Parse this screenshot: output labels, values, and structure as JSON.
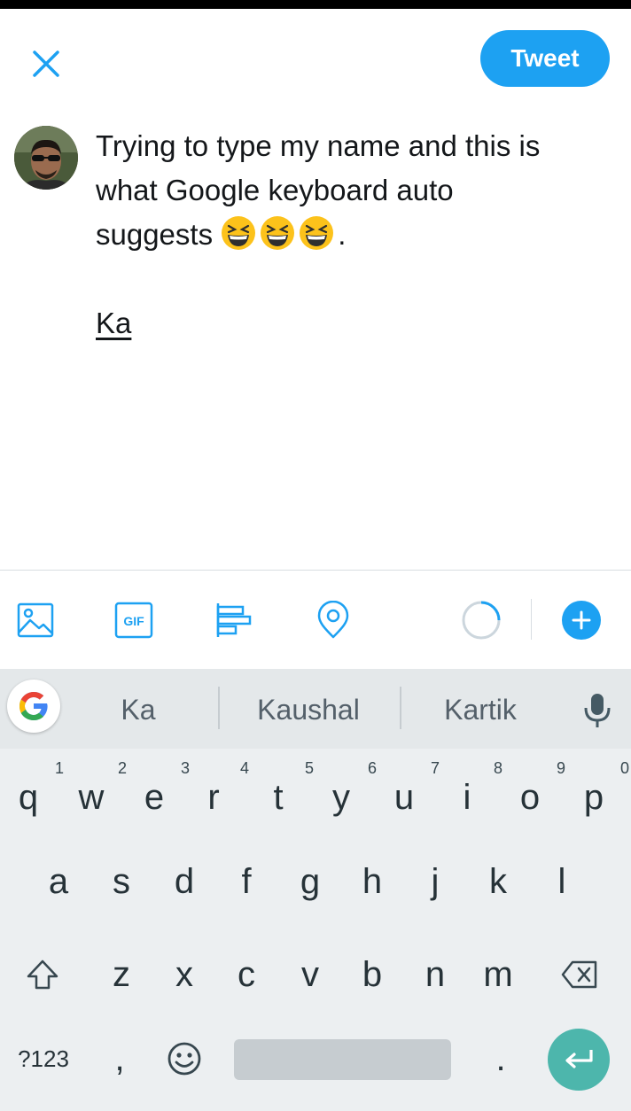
{
  "compose": {
    "tweet_label": "Tweet",
    "lines": [
      "Trying to type my name and this is",
      "what Google keyboard auto",
      "suggests"
    ],
    "emoji_name": "grinning-squinting-face",
    "emoji_count": 3,
    "after_emoji": ".",
    "composing_word": "Ka"
  },
  "toolbar": {
    "icons": [
      "image-icon",
      "gif-icon",
      "poll-icon",
      "location-icon"
    ],
    "gif_label": "GIF",
    "accent_color": "#1da1f2"
  },
  "keyboard": {
    "suggestions": [
      "Ka",
      "Kaushal",
      "Kartik"
    ],
    "row1": [
      "q",
      "w",
      "e",
      "r",
      "t",
      "y",
      "u",
      "i",
      "o",
      "p"
    ],
    "row1_hints": [
      "1",
      "2",
      "3",
      "4",
      "5",
      "6",
      "7",
      "8",
      "9",
      "0"
    ],
    "row2": [
      "a",
      "s",
      "d",
      "f",
      "g",
      "h",
      "j",
      "k",
      "l"
    ],
    "row3": [
      "z",
      "x",
      "c",
      "v",
      "b",
      "n",
      "m"
    ],
    "symbols_label": "?123",
    "comma": ",",
    "period": ".",
    "enter_color": "#4db6ac"
  }
}
